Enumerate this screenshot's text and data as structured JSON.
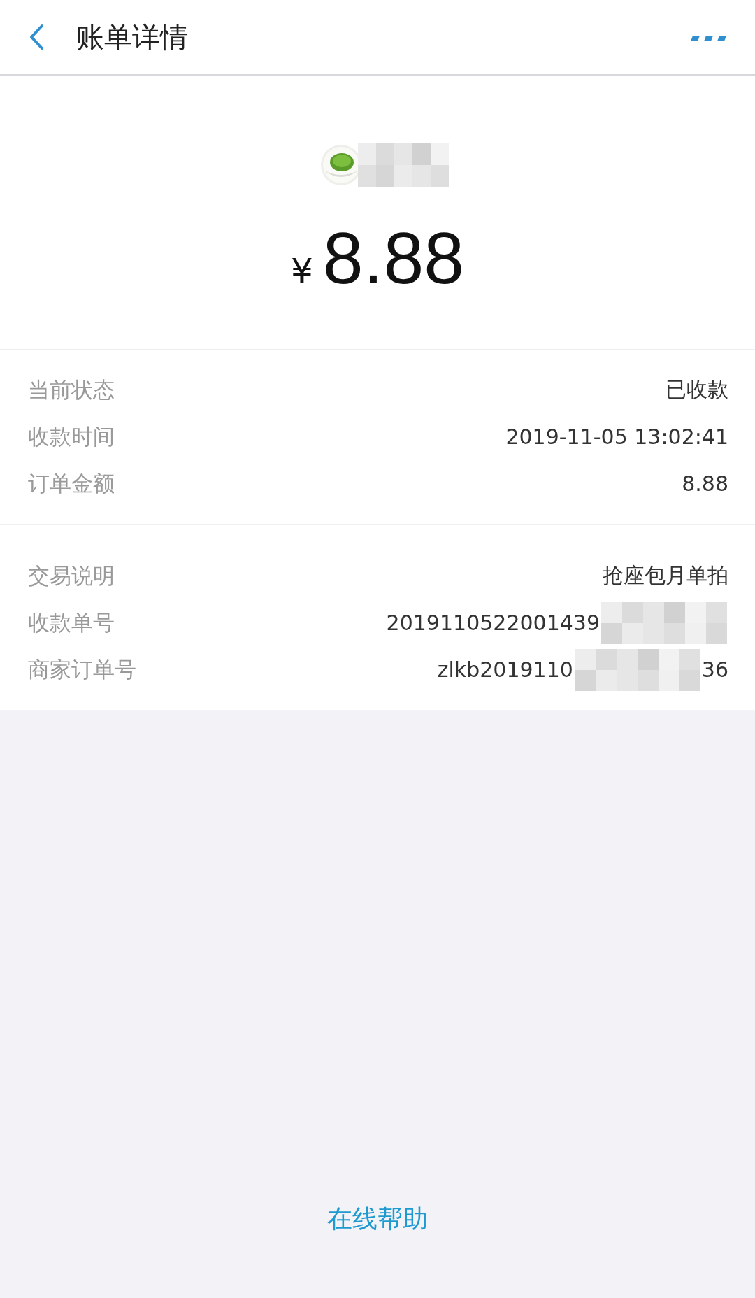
{
  "header": {
    "title": "账单详情"
  },
  "amount": {
    "currency": "¥",
    "value": "8.88"
  },
  "sections": [
    {
      "rows": [
        {
          "label": "当前状态",
          "value": "已收款"
        },
        {
          "label": "收款时间",
          "value": "2019-11-05 13:02:41"
        },
        {
          "label": "订单金额",
          "value": "8.88"
        }
      ]
    },
    {
      "rows": [
        {
          "label": "交易说明",
          "value": "抢座包月单拍"
        },
        {
          "label": "收款单号",
          "value": "2019110522001439",
          "redacted": true
        },
        {
          "label": "商家订单号",
          "value": "zlkb2019110",
          "redacted": true,
          "value_end": "36"
        }
      ]
    }
  ],
  "help_link": "在线帮助"
}
